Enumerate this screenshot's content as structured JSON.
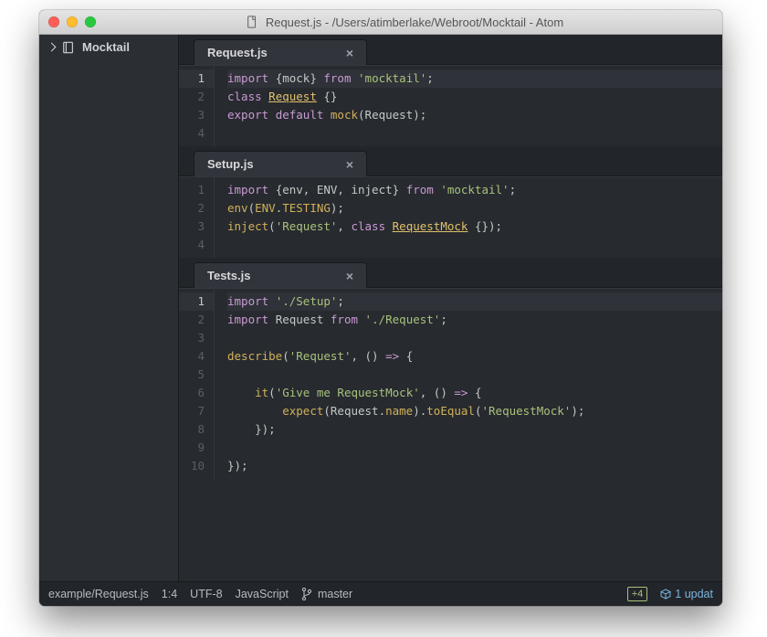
{
  "window_title": "Request.js - /Users/atimberlake/Webroot/Mocktail - Atom",
  "sidebar": {
    "project": "Mocktail"
  },
  "panes": [
    {
      "tab_label": "Request.js",
      "active_line": 1,
      "code_html": [
        "<span class='kw'>import</span> <span class='pn'>{mock}</span> <span class='kw'>from</span> <span class='str'>'mocktail'</span><span class='pn'>;</span>",
        "<span class='kw'>class</span> <span class='nm'>Request</span> <span class='pn'>{}</span>",
        "<span class='kw'>export</span> <span class='kw'>default</span> <span class='fn'>mock</span><span class='pn'>(Request);</span>",
        ""
      ]
    },
    {
      "tab_label": "Setup.js",
      "active_line": 0,
      "code_html": [
        "<span class='kw'>import</span> <span class='pn'>{env, ENV, inject}</span> <span class='kw'>from</span> <span class='str'>'mocktail'</span><span class='pn'>;</span>",
        "<span class='fn'>env</span><span class='pn'>(</span><span class='cn'>ENV</span><span class='pn'>.</span><span class='cn'>TESTING</span><span class='pn'>);</span>",
        "<span class='fn'>inject</span><span class='pn'>(</span><span class='str'>'Request'</span><span class='pn'>, </span><span class='kw'>class</span> <span class='nm'>RequestMock</span> <span class='pn'>{});</span>",
        ""
      ]
    },
    {
      "tab_label": "Tests.js",
      "active_line": 1,
      "code_html": [
        "<span class='kw'>import</span> <span class='str'>'./Setup'</span><span class='pn'>;</span>",
        "<span class='kw'>import</span> <span class='pn'>Request</span> <span class='kw'>from</span> <span class='str'>'./Request'</span><span class='pn'>;</span>",
        "",
        "<span class='fn'>describe</span><span class='pn'>(</span><span class='str'>'Request'</span><span class='pn'>, () </span><span class='kw'>=&gt;</span><span class='pn'> {</span>",
        "",
        "    <span class='fn'>it</span><span class='pn'>(</span><span class='str'>'Give me RequestMock'</span><span class='pn'>, () </span><span class='kw'>=&gt;</span><span class='pn'> {</span>",
        "        <span class='fn'>expect</span><span class='pn'>(Request.</span><span class='fn'>name</span><span class='pn'>).</span><span class='fn'>toEqual</span><span class='pn'>(</span><span class='str'>'RequestMock'</span><span class='pn'>);</span>",
        "    <span class='pn'>});</span>",
        "",
        "<span class='pn'>});</span>"
      ]
    }
  ],
  "status": {
    "path": "example/Request.js",
    "cursor": "1:4",
    "encoding": "UTF-8",
    "grammar": "JavaScript",
    "branch": "master",
    "git_plus": "+4",
    "updates": "1 updat"
  }
}
